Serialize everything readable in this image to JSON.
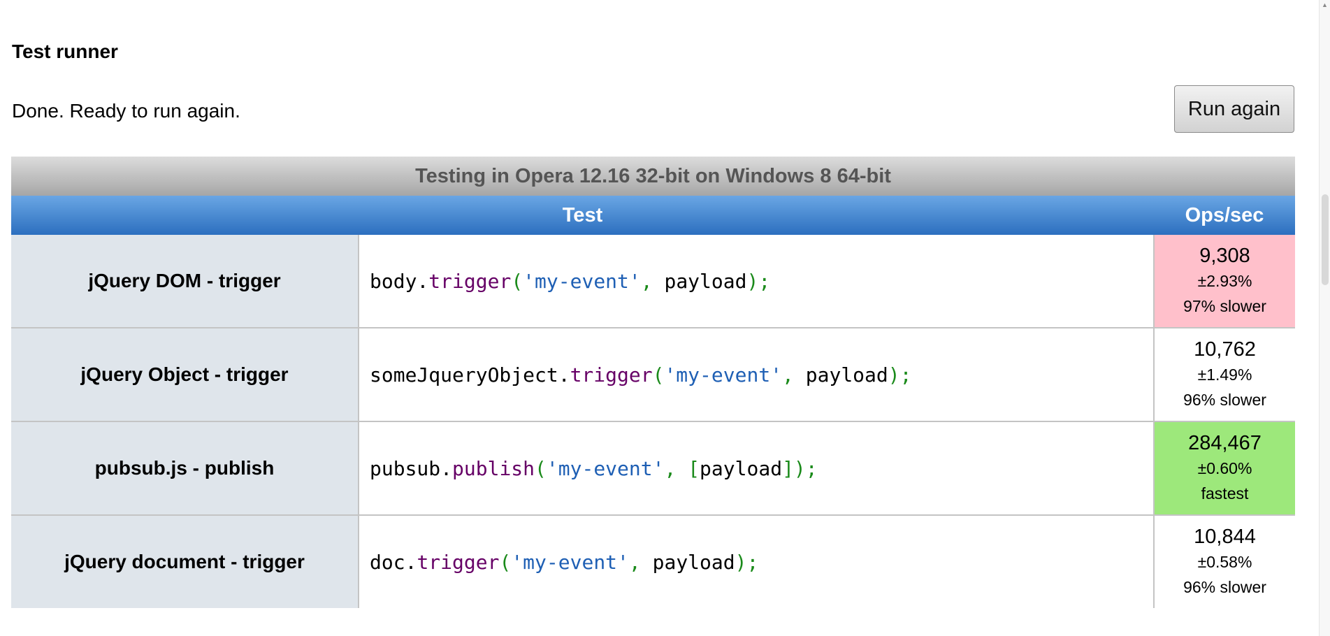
{
  "page": {
    "heading": "Test runner",
    "status_text": "Done. Ready to run again.",
    "run_button_label": "Run again"
  },
  "results_table": {
    "caption": "Testing in Opera 12.16 32-bit on Windows 8 64-bit",
    "columns": {
      "test": "Test",
      "ops": "Ops/sec"
    },
    "colors": {
      "slowest": "#ffc0cb",
      "fastest": "#9de87b",
      "header": "#2c6fbf"
    },
    "rows": [
      {
        "title": "jQuery DOM - trigger",
        "code": [
          {
            "t": "body",
            "k": "plain"
          },
          {
            "t": ".",
            "k": "plain"
          },
          {
            "t": "trigger",
            "k": "kw"
          },
          {
            "t": "(",
            "k": "pun"
          },
          {
            "t": "'my-event'",
            "k": "str"
          },
          {
            "t": ", ",
            "k": "pun"
          },
          {
            "t": "payload",
            "k": "plain"
          },
          {
            "t": ");",
            "k": "pun"
          }
        ],
        "ops": "9,308",
        "error": "±2.93%",
        "note": "97% slower",
        "highlight": "slowest"
      },
      {
        "title": "jQuery Object - trigger",
        "code": [
          {
            "t": "someJqueryObject",
            "k": "plain"
          },
          {
            "t": ".",
            "k": "plain"
          },
          {
            "t": "trigger",
            "k": "kw"
          },
          {
            "t": "(",
            "k": "pun"
          },
          {
            "t": "'my-event'",
            "k": "str"
          },
          {
            "t": ", ",
            "k": "pun"
          },
          {
            "t": "payload",
            "k": "plain"
          },
          {
            "t": ");",
            "k": "pun"
          }
        ],
        "ops": "10,762",
        "error": "±1.49%",
        "note": "96% slower",
        "highlight": ""
      },
      {
        "title": "pubsub.js - publish",
        "code": [
          {
            "t": "pubsub",
            "k": "plain"
          },
          {
            "t": ".",
            "k": "plain"
          },
          {
            "t": "publish",
            "k": "kw"
          },
          {
            "t": "(",
            "k": "pun"
          },
          {
            "t": "'my-event'",
            "k": "str"
          },
          {
            "t": ", ",
            "k": "pun"
          },
          {
            "t": "[",
            "k": "pun"
          },
          {
            "t": "payload",
            "k": "plain"
          },
          {
            "t": "]);",
            "k": "pun"
          }
        ],
        "ops": "284,467",
        "error": "±0.60%",
        "note": "fastest",
        "highlight": "fastest"
      },
      {
        "title": "jQuery document - trigger",
        "code": [
          {
            "t": "doc",
            "k": "plain"
          },
          {
            "t": ".",
            "k": "plain"
          },
          {
            "t": "trigger",
            "k": "kw"
          },
          {
            "t": "(",
            "k": "pun"
          },
          {
            "t": "'my-event'",
            "k": "str"
          },
          {
            "t": ", ",
            "k": "pun"
          },
          {
            "t": "payload",
            "k": "plain"
          },
          {
            "t": ");",
            "k": "pun"
          }
        ],
        "ops": "10,844",
        "error": "±0.58%",
        "note": "96% slower",
        "highlight": ""
      }
    ]
  }
}
